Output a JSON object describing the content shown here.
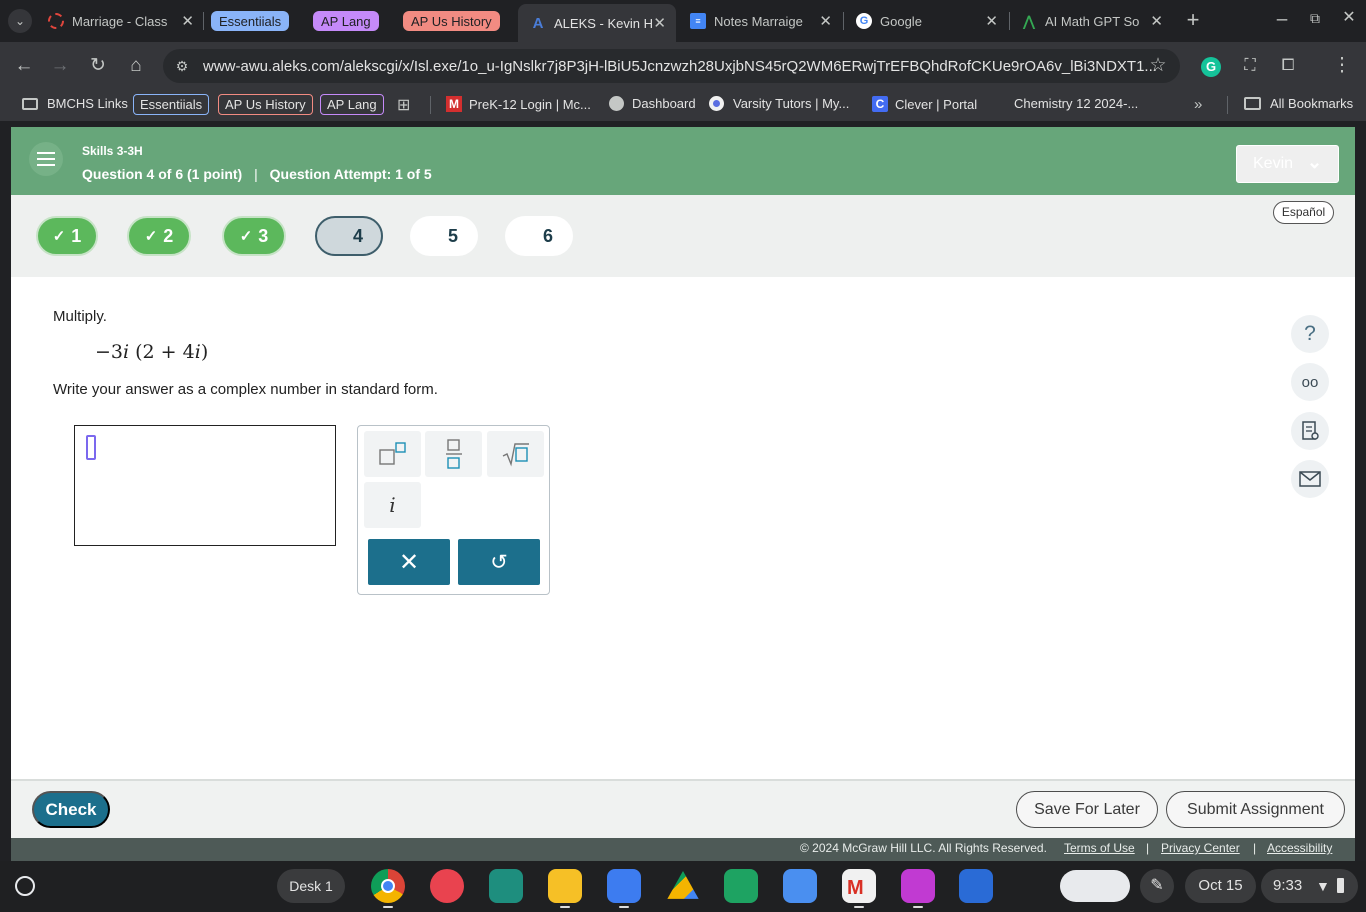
{
  "browser": {
    "tabs": [
      {
        "label": "Marriage - Class",
        "icon": "marriage-favicon"
      },
      {
        "label": "Essentiials",
        "group_color": "#8ab4f8"
      },
      {
        "label": "AP Lang",
        "group_color": "#c58af9"
      },
      {
        "label": "AP Us History",
        "group_color": "#f28b82"
      },
      {
        "label": "ALEKS - Kevin H",
        "icon": "aleks-favicon",
        "active": true
      },
      {
        "label": "Notes Marraige",
        "icon": "docs-favicon"
      },
      {
        "label": "Google",
        "icon": "google-favicon"
      },
      {
        "label": "AI Math GPT So",
        "icon": "ai-math-favicon"
      }
    ],
    "url": "www-awu.aleks.com/alekscgi/x/Isl.exe/1o_u-IgNslkr7j8P3jH-lBiU5Jcnzwzh28UxjbNS45rQ2WM6ERwjTrEFBQhdRofCKUe9rOA6v_lBi3NDXT1...",
    "bookmarks": [
      {
        "label": "BMCHS Links",
        "type": "folder"
      },
      {
        "label": "Essentiials",
        "type": "group",
        "color": "#8ab4f8"
      },
      {
        "label": "AP Us History",
        "type": "group",
        "color": "#f28b82"
      },
      {
        "label": "AP Lang",
        "type": "group",
        "color": "#c58af9"
      },
      {
        "label": "PreK-12 Login | Mc...",
        "type": "link"
      },
      {
        "label": "Dashboard",
        "type": "link"
      },
      {
        "label": "Varsity Tutors | My...",
        "type": "link"
      },
      {
        "label": "Clever | Portal",
        "type": "link"
      },
      {
        "label": "Chemistry 12 2024-...",
        "type": "link"
      },
      {
        "label": "All Bookmarks",
        "type": "folder"
      }
    ]
  },
  "header": {
    "course": "Skills 3-3H",
    "question_info": "Question 4 of 6 (1 point)",
    "separator": "|",
    "attempt_info": "Question Attempt: 1 of 5",
    "user": "Kevin"
  },
  "questions": [
    {
      "label": "1",
      "state": "done"
    },
    {
      "label": "2",
      "state": "done"
    },
    {
      "label": "3",
      "state": "done"
    },
    {
      "label": "4",
      "state": "current"
    },
    {
      "label": "5",
      "state": "todo"
    },
    {
      "label": "6",
      "state": "todo"
    }
  ],
  "language_link": "Español",
  "problem": {
    "instruction": "Multiply.",
    "expression": {
      "neg": "−3",
      "i1": "i",
      "open": "(2 + 4",
      "i2": "i",
      "close": ")"
    },
    "direction": "Write your answer as a complex number in standard form."
  },
  "keypad": {
    "i_key": "i"
  },
  "footer": {
    "check": "Check",
    "save_later": "Save For Later",
    "submit": "Submit Assignment",
    "copyright": "© 2024 McGraw Hill LLC. All Rights Reserved.",
    "links": [
      "Terms of Use",
      "Privacy Center",
      "Accessibility"
    ],
    "sep": "|"
  },
  "shelf": {
    "desk": "Desk 1",
    "date": "Oct 15",
    "time": "9:33"
  },
  "colors": {
    "aleks_green": "#67a67a",
    "done_green": "#5cb85c",
    "teal_button": "#1c6f8c"
  }
}
